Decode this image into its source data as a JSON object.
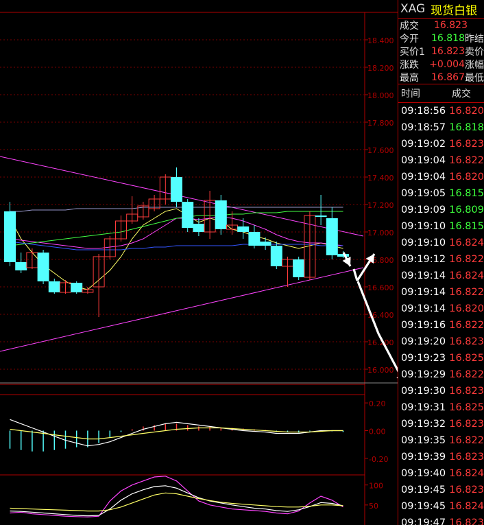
{
  "header": {
    "symbol": "XAG",
    "name": "现货白银"
  },
  "quote": [
    {
      "label": "成交",
      "value": "16.823",
      "color": "red",
      "extra": ""
    },
    {
      "label": "今开",
      "value": "16.818",
      "color": "green",
      "extra": "昨结"
    },
    {
      "label": "买价1",
      "value": "16.823",
      "color": "red",
      "extra": "卖价"
    },
    {
      "label": "涨跌",
      "value": "+0.004",
      "color": "red",
      "extra": "涨幅"
    },
    {
      "label": "最高",
      "value": "16.867",
      "color": "red",
      "extra": "最低"
    }
  ],
  "ticks_header": {
    "time": "时间",
    "price": "成交"
  },
  "ticks": [
    {
      "time": "09:18:56",
      "price": "16.820",
      "color": "red"
    },
    {
      "time": "09:18:57",
      "price": "16.818",
      "color": "green"
    },
    {
      "time": "09:19:02",
      "price": "16.823",
      "color": "red"
    },
    {
      "time": "09:19:04",
      "price": "16.822",
      "color": "red"
    },
    {
      "time": "09:19:04",
      "price": "16.820",
      "color": "red"
    },
    {
      "time": "09:19:05",
      "price": "16.815",
      "color": "green"
    },
    {
      "time": "09:19:09",
      "price": "16.809",
      "color": "green"
    },
    {
      "time": "09:19:10",
      "price": "16.815",
      "color": "green"
    },
    {
      "time": "09:19:10",
      "price": "16.824",
      "color": "red"
    },
    {
      "time": "09:19:12",
      "price": "16.822",
      "color": "red"
    },
    {
      "time": "09:19:14",
      "price": "16.824",
      "color": "red"
    },
    {
      "time": "09:19:14",
      "price": "16.822",
      "color": "red"
    },
    {
      "time": "09:19:14",
      "price": "16.820",
      "color": "red"
    },
    {
      "time": "09:19:16",
      "price": "16.822",
      "color": "red"
    },
    {
      "time": "09:19:20",
      "price": "16.823",
      "color": "red"
    },
    {
      "time": "09:19:23",
      "price": "16.825",
      "color": "red"
    },
    {
      "time": "09:19:29",
      "price": "16.822",
      "color": "red"
    },
    {
      "time": "09:19:30",
      "price": "16.823",
      "color": "red"
    },
    {
      "time": "09:19:31",
      "price": "16.825",
      "color": "red"
    },
    {
      "time": "09:19:32",
      "price": "16.823",
      "color": "red"
    },
    {
      "time": "09:19:35",
      "price": "16.822",
      "color": "red"
    },
    {
      "time": "09:19:39",
      "price": "16.823",
      "color": "red"
    },
    {
      "time": "09:19:40",
      "price": "16.824",
      "color": "red"
    },
    {
      "time": "09:19:45",
      "price": "16.823",
      "color": "red"
    },
    {
      "time": "09:19:45",
      "price": "16.824",
      "color": "red"
    },
    {
      "time": "09:19:47",
      "price": "16.823",
      "color": "red"
    }
  ],
  "colors": {
    "up": "#ff3b3b",
    "down": "#54ffff",
    "axis": "#b00000",
    "ma5": "#ffff66",
    "ma10": "#ff44ff",
    "ma20": "#44ff44",
    "ma60": "#3355ff",
    "ma120": "#9999cc",
    "trend": "#ff44ff",
    "arrow": "#ffffff"
  },
  "chart_data": [
    {
      "type": "candlestick",
      "ylim": [
        15.9,
        18.5
      ],
      "yticks": [
        "18.400",
        "18.200",
        "18.000",
        "17.800",
        "17.600",
        "17.400",
        "17.200",
        "17.000",
        "16.800",
        "16.600",
        "16.400",
        "16.200",
        "16.000"
      ],
      "ytick_values": [
        18.4,
        18.2,
        18.0,
        17.8,
        17.6,
        17.4,
        17.2,
        17.0,
        16.8,
        16.6,
        16.4,
        16.2,
        16.0
      ],
      "candles": [
        {
          "o": 17.15,
          "c": 16.78,
          "h": 17.22,
          "l": 16.75
        },
        {
          "o": 16.78,
          "c": 16.72,
          "h": 16.85,
          "l": 16.7
        },
        {
          "o": 16.74,
          "c": 16.85,
          "h": 16.88,
          "l": 16.73
        },
        {
          "o": 16.85,
          "c": 16.64,
          "h": 16.87,
          "l": 16.62
        },
        {
          "o": 16.64,
          "c": 16.56,
          "h": 16.66,
          "l": 16.55
        },
        {
          "o": 16.56,
          "c": 16.63,
          "h": 16.65,
          "l": 16.55
        },
        {
          "o": 16.63,
          "c": 16.56,
          "h": 16.64,
          "l": 16.55
        },
        {
          "o": 16.56,
          "c": 16.58,
          "h": 16.6,
          "l": 16.55
        },
        {
          "o": 16.6,
          "c": 16.82,
          "h": 16.84,
          "l": 16.38
        },
        {
          "o": 16.82,
          "c": 16.95,
          "h": 16.97,
          "l": 16.8
        },
        {
          "o": 16.95,
          "c": 17.08,
          "h": 17.12,
          "l": 16.93
        },
        {
          "o": 17.08,
          "c": 17.13,
          "h": 17.26,
          "l": 17.06
        },
        {
          "o": 17.11,
          "c": 17.19,
          "h": 17.22,
          "l": 17.09
        },
        {
          "o": 17.17,
          "c": 17.24,
          "h": 17.27,
          "l": 17.15
        },
        {
          "o": 17.24,
          "c": 17.4,
          "h": 17.42,
          "l": 17.2
        },
        {
          "o": 17.4,
          "c": 17.22,
          "h": 17.47,
          "l": 17.18
        },
        {
          "o": 17.22,
          "c": 17.03,
          "h": 17.24,
          "l": 17.0
        },
        {
          "o": 17.06,
          "c": 17.0,
          "h": 17.1,
          "l": 16.97
        },
        {
          "o": 17.0,
          "c": 17.23,
          "h": 17.3,
          "l": 16.95
        },
        {
          "o": 17.23,
          "c": 17.02,
          "h": 17.27,
          "l": 16.98
        },
        {
          "o": 17.02,
          "c": 17.05,
          "h": 17.15,
          "l": 16.98
        },
        {
          "o": 17.04,
          "c": 17.0,
          "h": 17.1,
          "l": 16.95
        },
        {
          "o": 17.0,
          "c": 16.9,
          "h": 17.05,
          "l": 16.88
        },
        {
          "o": 16.93,
          "c": 16.9,
          "h": 16.96,
          "l": 16.87
        },
        {
          "o": 16.9,
          "c": 16.75,
          "h": 16.93,
          "l": 16.73
        },
        {
          "o": 16.75,
          "c": 16.8,
          "h": 16.82,
          "l": 16.6
        },
        {
          "o": 16.8,
          "c": 16.67,
          "h": 16.82,
          "l": 16.65
        },
        {
          "o": 16.67,
          "c": 17.12,
          "h": 17.15,
          "l": 16.65
        },
        {
          "o": 17.12,
          "c": 17.11,
          "h": 17.27,
          "l": 17.05
        },
        {
          "o": 17.1,
          "c": 16.83,
          "h": 17.18,
          "l": 16.8
        },
        {
          "o": 16.84,
          "c": 16.82,
          "h": 16.86,
          "l": 16.81
        }
      ],
      "ma_lines": [
        {
          "key": "ma5",
          "values": [
            17.1,
            16.95,
            16.85,
            16.76,
            16.7,
            16.64,
            16.6,
            16.58,
            16.65,
            16.72,
            16.82,
            16.95,
            17.05,
            17.1,
            17.15,
            17.17,
            17.12,
            17.07,
            17.1,
            17.08,
            17.02,
            17.0,
            16.97,
            16.95,
            16.92,
            16.9,
            16.88,
            16.9,
            16.92,
            16.9,
            16.88
          ]
        },
        {
          "key": "ma10",
          "values": [
            16.95,
            16.94,
            16.93,
            16.92,
            16.91,
            16.9,
            16.89,
            16.88,
            16.88,
            16.89,
            16.9,
            16.92,
            16.95,
            17.0,
            17.05,
            17.1,
            17.1,
            17.09,
            17.1,
            17.11,
            17.1,
            17.08,
            17.05,
            17.02,
            16.98,
            16.95,
            16.93,
            16.92,
            16.92,
            16.91,
            16.9
          ]
        },
        {
          "key": "ma20",
          "values": [
            16.9,
            16.91,
            16.92,
            16.93,
            16.94,
            16.95,
            16.96,
            16.97,
            16.98,
            16.99,
            17.0,
            17.02,
            17.04,
            17.06,
            17.08,
            17.1,
            17.11,
            17.12,
            17.12,
            17.12,
            17.13,
            17.13,
            17.14,
            17.14,
            17.14,
            17.15,
            17.15,
            17.15,
            17.15,
            17.15,
            17.15
          ]
        },
        {
          "key": "ma60",
          "values": [
            16.93,
            16.92,
            16.91,
            16.9,
            16.89,
            16.88,
            16.87,
            16.87,
            16.87,
            16.87,
            16.87,
            16.88,
            16.88,
            16.89,
            16.89,
            16.9,
            16.9,
            16.9,
            16.9,
            16.9,
            16.9,
            16.91,
            16.91,
            16.91,
            16.91,
            16.91,
            16.91,
            16.91,
            16.9,
            16.9,
            16.9
          ]
        },
        {
          "key": "ma120",
          "values": [
            17.15,
            17.15,
            17.16,
            17.16,
            17.16,
            17.16,
            17.17,
            17.17,
            17.17,
            17.17,
            17.17,
            17.17,
            17.18,
            17.18,
            17.18,
            17.18,
            17.18,
            17.18,
            17.18,
            17.18,
            17.18,
            17.18,
            17.18,
            17.18,
            17.18,
            17.18,
            17.18,
            17.18,
            17.18,
            17.18,
            17.18
          ]
        }
      ]
    },
    {
      "type": "bar",
      "yticks": [
        "0.20",
        "0.00",
        "-0.20"
      ],
      "ytick_values": [
        0.2,
        0.0,
        -0.2
      ],
      "ylim": [
        -0.26,
        0.26
      ],
      "values": [
        -0.13,
        -0.14,
        -0.15,
        -0.15,
        -0.14,
        -0.13,
        -0.12,
        -0.12,
        -0.09,
        -0.05,
        -0.01,
        0.01,
        0.03,
        0.04,
        0.05,
        0.05,
        0.04,
        0.03,
        0.03,
        0.02,
        0.02,
        0.015,
        0.01,
        0.005,
        -0.01,
        -0.01,
        -0.015,
        -0.005,
        0.0,
        -0.005,
        -0.01
      ],
      "lines": [
        {
          "key": "ma5",
          "values": [
            0.08,
            0.05,
            0.02,
            -0.01,
            -0.04,
            -0.07,
            -0.09,
            -0.11,
            -0.1,
            -0.08,
            -0.05,
            -0.02,
            0.01,
            0.03,
            0.05,
            0.06,
            0.05,
            0.04,
            0.03,
            0.02,
            0.01,
            0.0,
            -0.005,
            -0.01,
            -0.02,
            -0.02,
            -0.02,
            -0.01,
            0.0,
            0.0,
            0.0
          ]
        },
        {
          "key": "ma10",
          "values": [
            0.01,
            0.0,
            -0.01,
            -0.02,
            -0.03,
            -0.04,
            -0.05,
            -0.06,
            -0.06,
            -0.05,
            -0.04,
            -0.03,
            -0.02,
            -0.01,
            0.0,
            0.01,
            0.015,
            0.02,
            0.02,
            0.02,
            0.015,
            0.01,
            0.005,
            0.0,
            -0.005,
            -0.01,
            -0.01,
            -0.01,
            -0.005,
            0.0,
            0.0
          ]
        }
      ]
    },
    {
      "type": "line",
      "yticks": [
        "100",
        "50"
      ],
      "ytick_values": [
        100,
        50
      ],
      "ylim": [
        0,
        120
      ],
      "series": [
        {
          "key": "ma10",
          "values": [
            30,
            32,
            28,
            26,
            24,
            22,
            21,
            20,
            22,
            60,
            85,
            100,
            110,
            120,
            122,
            110,
            85,
            60,
            50,
            45,
            40,
            38,
            36,
            34,
            30,
            28,
            35,
            55,
            72,
            62,
            45
          ]
        },
        {
          "key": "ma5",
          "values": [
            35,
            34,
            32,
            30,
            28,
            26,
            24,
            23,
            24,
            40,
            62,
            78,
            88,
            96,
            98,
            92,
            80,
            68,
            60,
            55,
            50,
            46,
            42,
            40,
            36,
            34,
            38,
            46,
            56,
            54,
            48
          ]
        },
        {
          "key": "ma20",
          "values": [
            42,
            41,
            40,
            39,
            38,
            37,
            36,
            35,
            35,
            38,
            45,
            55,
            65,
            75,
            80,
            78,
            72,
            66,
            61,
            57,
            54,
            52,
            50,
            48,
            46,
            45,
            45,
            47,
            50,
            50,
            48
          ]
        }
      ]
    }
  ]
}
